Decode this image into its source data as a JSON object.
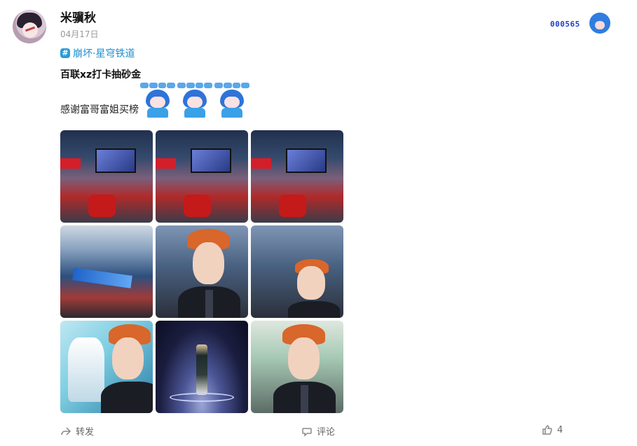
{
  "user": {
    "name": "米骥秋",
    "date": "04月17日"
  },
  "badge": {
    "number": "000565"
  },
  "topic": {
    "icon": "#",
    "label": "崩坏·星穹铁道"
  },
  "post": {
    "title": "百联xz打卡抽砂金",
    "text": "感谢富哥富姐买榜",
    "sticker_count": 3
  },
  "photos": [
    {
      "kind": "mall"
    },
    {
      "kind": "mall"
    },
    {
      "kind": "mall"
    },
    {
      "kind": "hall"
    },
    {
      "kind": "selfie"
    },
    {
      "kind": "selfie-small"
    },
    {
      "kind": "poster-selfie"
    },
    {
      "kind": "space"
    },
    {
      "kind": "booth-selfie"
    }
  ],
  "actions": {
    "share_label": "转发",
    "comment_label": "评论",
    "like_count": "4"
  },
  "colors": {
    "topic": "#1a8ed1",
    "badge": "#1d3fc7",
    "muted": "#999999"
  }
}
